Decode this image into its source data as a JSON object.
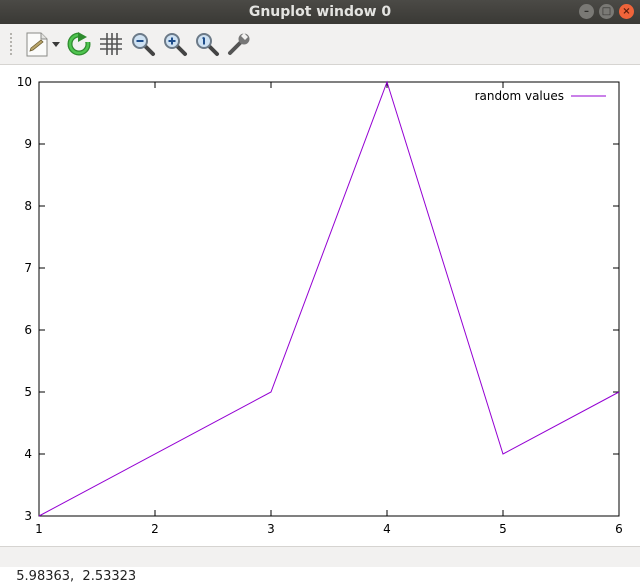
{
  "window": {
    "title": "Gnuplot window 0"
  },
  "toolbar": {
    "buttons": [
      {
        "name": "export-button",
        "icon": "export-document-icon"
      },
      {
        "name": "replot-button",
        "icon": "refresh-icon"
      },
      {
        "name": "grid-button",
        "icon": "grid-icon"
      },
      {
        "name": "zoom-out-button",
        "icon": "zoom-out-icon"
      },
      {
        "name": "zoom-in-button",
        "icon": "zoom-in-icon"
      },
      {
        "name": "zoom-reset-button",
        "icon": "zoom-fit-icon"
      },
      {
        "name": "settings-button",
        "icon": "wrench-icon"
      }
    ]
  },
  "status": {
    "coords": "5.98363,  2.53323"
  },
  "colors": {
    "series": "#9400d3",
    "titlebar": "#3d3c38",
    "close": "#f0643a"
  },
  "chart_data": {
    "type": "line",
    "x": [
      1,
      3,
      4,
      5,
      6
    ],
    "series": [
      {
        "name": "random values",
        "values": [
          3,
          5,
          10,
          4,
          5
        ]
      }
    ],
    "xlim": [
      1,
      6
    ],
    "ylim": [
      3,
      10
    ],
    "xticks": [
      "1",
      "2",
      "3",
      "4",
      "5",
      "6"
    ],
    "yticks": [
      "3",
      "4",
      "5",
      "6",
      "7",
      "8",
      "9",
      "10"
    ],
    "legend": "top-right",
    "grid": false
  }
}
